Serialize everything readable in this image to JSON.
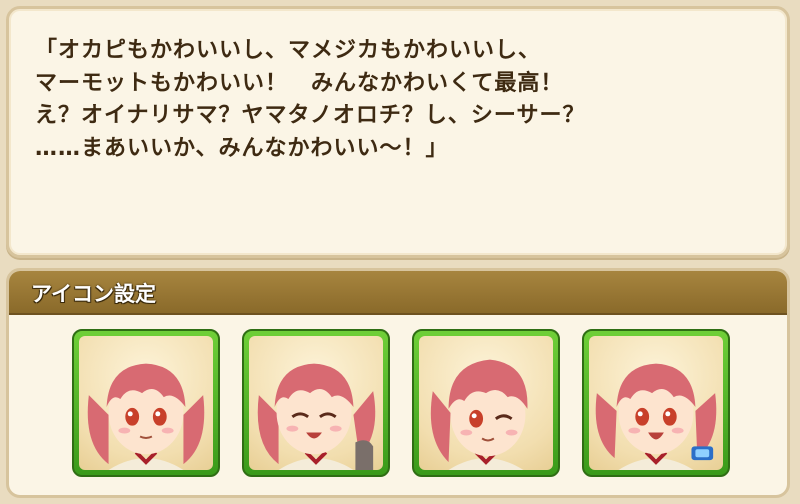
{
  "dialog": {
    "lines": [
      "「オカピもかわいいし、マメジカもかわいいし、",
      "マーモットもかわいい！　みんなかわいくて最高！",
      "え？オイナリサマ？ヤマタノオロチ？し、シーサー？",
      "……まあいいか、みんなかわいい～！」"
    ]
  },
  "icon_settings": {
    "title": "アイコン設定",
    "icons": [
      {
        "name": "portrait-neutral-icon",
        "expression": "neutral"
      },
      {
        "name": "portrait-smile-closed-eyes-icon",
        "expression": "smile-closed-eyes"
      },
      {
        "name": "portrait-wink-icon",
        "expression": "wink"
      },
      {
        "name": "portrait-happy-open-mouth-icon",
        "expression": "happy-open-mouth"
      }
    ]
  },
  "colors": {
    "frame_green": "#4cae24",
    "header_brown": "#9a7a36",
    "hair_pink": "#d86a72",
    "text_dark": "#3e2a12"
  }
}
